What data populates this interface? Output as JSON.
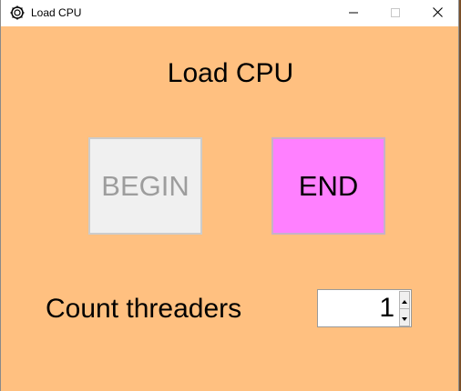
{
  "window": {
    "title": "Load CPU",
    "icon": "cpu-gear-icon",
    "minimize_icon": "minimize-icon",
    "maximize_icon": "maximize-icon",
    "close_icon": "close-icon"
  },
  "main": {
    "heading": "Load CPU",
    "begin_label": "BEGIN",
    "end_label": "END",
    "count_label": "Count threaders",
    "count_value": "1"
  },
  "colors": {
    "window_background": "#ffc080",
    "begin_button": "#f0f0f0",
    "begin_text_disabled": "#9d9d9d",
    "end_button": "#ff80ff"
  }
}
